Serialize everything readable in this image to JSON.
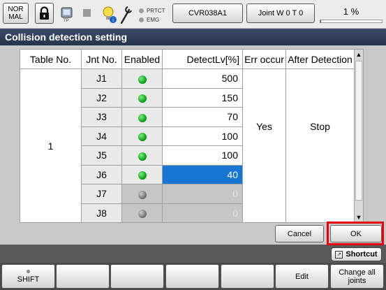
{
  "topbar": {
    "mode_line1": "NOR",
    "mode_line2": "MAL",
    "tp_label": "TP",
    "indicator1": "PRTCT",
    "indicator2": "EMG",
    "robot_label": "CVR038A1",
    "joint_label": "Joint  W 0 T 0",
    "speed_text": "1 %",
    "speed_fraction": 0.01
  },
  "title": "Collision detection setting",
  "table": {
    "headers": [
      "Table No.",
      "Jnt No.",
      "Enabled",
      "DetectLv[%]",
      "Err occur",
      "After Detection"
    ],
    "table_no": "1",
    "err_occur": "Yes",
    "after_detection": "Stop",
    "rows": [
      {
        "jnt": "J1",
        "enabled": true,
        "level": "500"
      },
      {
        "jnt": "J2",
        "enabled": true,
        "level": "150"
      },
      {
        "jnt": "J3",
        "enabled": true,
        "level": "70"
      },
      {
        "jnt": "J4",
        "enabled": true,
        "level": "100"
      },
      {
        "jnt": "J5",
        "enabled": true,
        "level": "100"
      },
      {
        "jnt": "J6",
        "enabled": true,
        "level": "40"
      },
      {
        "jnt": "J7",
        "enabled": false,
        "level": "0"
      },
      {
        "jnt": "J8",
        "enabled": false,
        "level": "0"
      }
    ]
  },
  "buttons": {
    "cancel": "Cancel",
    "ok": "OK",
    "shortcut": "Shortcut"
  },
  "fkeys": {
    "shift": "SHIFT",
    "f5": "Edit",
    "f6_line1": "Change all",
    "f6_line2": "joints"
  },
  "colors": {
    "selected_cell": "#1676d2",
    "enabled_led": "#0a9d1a",
    "disabled_led": "#707070",
    "highlight_box": "#e00010"
  }
}
